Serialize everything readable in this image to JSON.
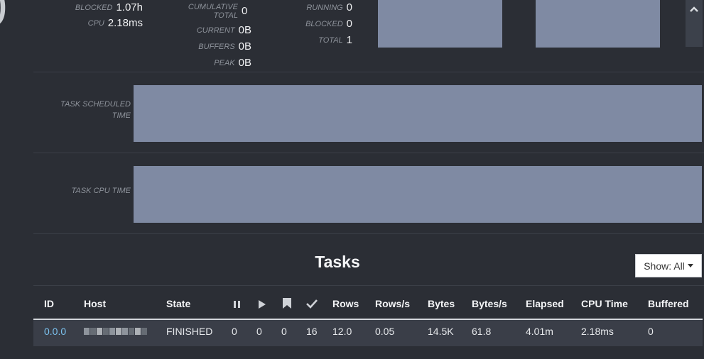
{
  "page": {
    "partial_digit": "0"
  },
  "top_stats": {
    "time": [
      {
        "label": "BLOCKED",
        "value": "1.07h"
      },
      {
        "label": "CPU",
        "value": "2.18ms"
      }
    ],
    "memory": [
      {
        "label": "CUMULATIVE TOTAL",
        "value": "0"
      },
      {
        "label": "CURRENT",
        "value": "0B"
      },
      {
        "label": "BUFFERS",
        "value": "0B"
      },
      {
        "label": "PEAK",
        "value": "0B"
      }
    ],
    "tasks": [
      {
        "label": "RUNNING",
        "value": "0"
      },
      {
        "label": "BLOCKED",
        "value": "0"
      },
      {
        "label": "TOTAL",
        "value": "1"
      }
    ]
  },
  "scroll_icon": "chevron-up-icon",
  "charts": {
    "scheduled": {
      "label": "TASK SCHEDULED TIME"
    },
    "cpu": {
      "label": "TASK CPU TIME"
    }
  },
  "tasks_section": {
    "title": "Tasks",
    "show_label": "Show: All",
    "columns": [
      "ID",
      "Host",
      "State",
      "pause-icon",
      "play-icon",
      "bookmark-icon",
      "check-icon",
      "Rows",
      "Rows/s",
      "Bytes",
      "Bytes/s",
      "Elapsed",
      "CPU Time",
      "Buffered"
    ],
    "rows": [
      {
        "id": "0.0.0",
        "host": "",
        "state": "FINISHED",
        "paused": "0",
        "running": "0",
        "blocked": "0",
        "finished": "16",
        "rows": "12.0",
        "rows_per_s": "0.05",
        "bytes": "14.5K",
        "bytes_per_s": "61.8",
        "elapsed": "4.01m",
        "cpu_time": "2.18ms",
        "buffered": "0"
      }
    ]
  },
  "colors": {
    "background": "#2b2e35",
    "bar": "#7f8aa3",
    "link": "#7cc3f0"
  }
}
